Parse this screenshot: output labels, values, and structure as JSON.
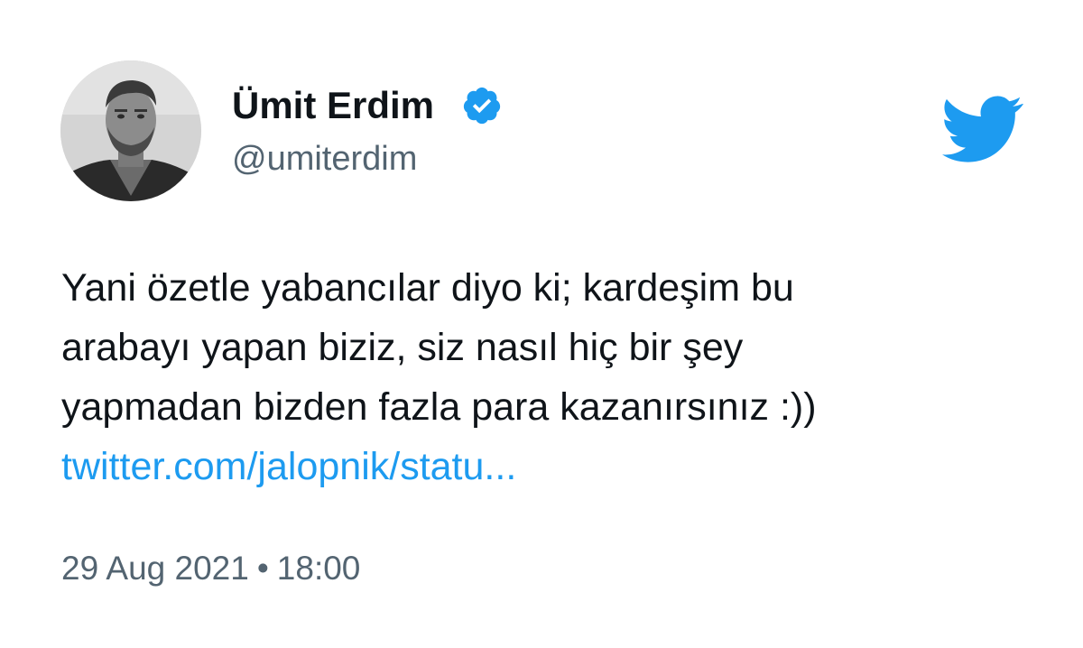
{
  "author": {
    "display_name": "Ümit Erdim",
    "handle": "@umiterdim",
    "verified": true
  },
  "tweet": {
    "text_lines": [
      "Yani özetle yabancılar diyo ki; kardeşim bu",
      "arabayı yapan biziz, siz nasıl hiç bir şey",
      "yapmadan bizden fazla para kazanırsınız :))"
    ],
    "link_text": "twitter.com/jalopnik/statu..."
  },
  "meta": {
    "date": "29 Aug 2021",
    "separator": "•",
    "time": "18:00"
  },
  "colors": {
    "link": "#1d9bf0",
    "verified_badge": "#1d9bf0",
    "twitter_brand": "#1d9bf0",
    "secondary_text": "#536471",
    "primary_text": "#0f1419"
  },
  "icons": {
    "brand": "twitter-bird-icon",
    "verified": "verified-badge-icon"
  }
}
